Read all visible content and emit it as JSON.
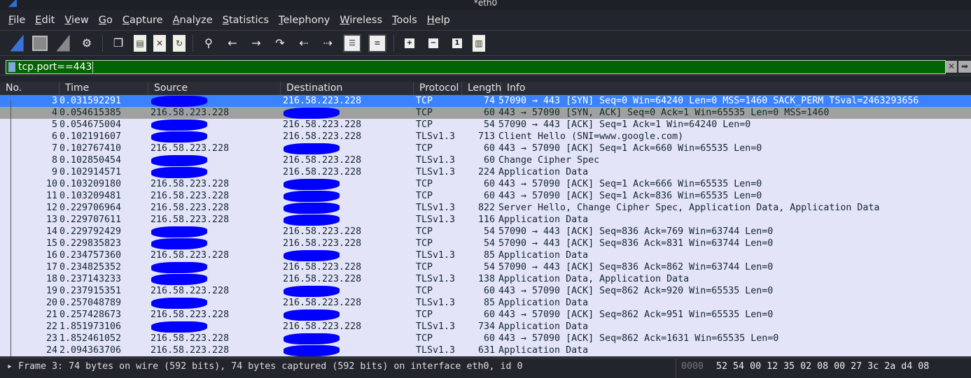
{
  "window": {
    "title": "*eth0"
  },
  "menu": [
    "File",
    "Edit",
    "View",
    "Go",
    "Capture",
    "Analyze",
    "Statistics",
    "Telephony",
    "Wireless",
    "Tools",
    "Help"
  ],
  "toolbar": {
    "icons": [
      "start-capture",
      "stop-capture",
      "restart-capture",
      "capture-options",
      "open-file",
      "file-info",
      "close-file",
      "reload-file",
      "find-packet",
      "go-back",
      "go-forward",
      "go-to-packet",
      "first-packet",
      "last-packet",
      "auto-scroll",
      "colorize",
      "zoom-in",
      "zoom-out",
      "normal-size",
      "resize-columns"
    ]
  },
  "filter": {
    "value": "tcp.port==443"
  },
  "columns": [
    "No.",
    "Time",
    "Source",
    "Destination",
    "Protocol",
    "Length",
    "Info"
  ],
  "colors": {
    "selected": "#3b82ff",
    "row": "#e4e4f8",
    "filter_ok": "#006400",
    "redaction": "#0000ff"
  },
  "packets": [
    {
      "no": "3",
      "time": "0.031592291",
      "src": "",
      "dst": "216.58.223.228",
      "proto": "TCP",
      "len": "74",
      "info": "57090 → 443 [SYN] Seq=0 Win=64240 Len=0 MSS=1460 SACK_PERM TSval=2463293656"
    },
    {
      "no": "4",
      "time": "0.054615385",
      "src": "216.58.223.228",
      "dst": "",
      "proto": "TCP",
      "len": "60",
      "info": "443 → 57090 [SYN, ACK] Seq=0 Ack=1 Win=65535 Len=0 MSS=1460"
    },
    {
      "no": "5",
      "time": "0.054675004",
      "src": "",
      "dst": "216.58.223.228",
      "proto": "TCP",
      "len": "54",
      "info": "57090 → 443 [ACK] Seq=1 Ack=1 Win=64240 Len=0"
    },
    {
      "no": "6",
      "time": "0.102191607",
      "src": "",
      "dst": "216.58.223.228",
      "proto": "TLSv1.3",
      "len": "713",
      "info": "Client Hello (SNI=www.google.com)"
    },
    {
      "no": "7",
      "time": "0.102767410",
      "src": "216.58.223.228",
      "dst": "",
      "proto": "TCP",
      "len": "60",
      "info": "443 → 57090 [ACK] Seq=1 Ack=660 Win=65535 Len=0"
    },
    {
      "no": "8",
      "time": "0.102850454",
      "src": "",
      "dst": "216.58.223.228",
      "proto": "TLSv1.3",
      "len": "60",
      "info": "Change Cipher Spec"
    },
    {
      "no": "9",
      "time": "0.102914571",
      "src": "",
      "dst": "216.58.223.228",
      "proto": "TLSv1.3",
      "len": "224",
      "info": "Application Data"
    },
    {
      "no": "10",
      "time": "0.103209180",
      "src": "216.58.223.228",
      "dst": "",
      "proto": "TCP",
      "len": "60",
      "info": "443 → 57090 [ACK] Seq=1 Ack=666 Win=65535 Len=0"
    },
    {
      "no": "11",
      "time": "0.103209481",
      "src": "216.58.223.228",
      "dst": "",
      "proto": "TCP",
      "len": "60",
      "info": "443 → 57090 [ACK] Seq=1 Ack=836 Win=65535 Len=0"
    },
    {
      "no": "12",
      "time": "0.229706964",
      "src": "216.58.223.228",
      "dst": "",
      "proto": "TLSv1.3",
      "len": "822",
      "info": "Server Hello, Change Cipher Spec, Application Data, Application Data"
    },
    {
      "no": "13",
      "time": "0.229707611",
      "src": "216.58.223.228",
      "dst": "",
      "proto": "TLSv1.3",
      "len": "116",
      "info": "Application Data"
    },
    {
      "no": "14",
      "time": "0.229792429",
      "src": "",
      "dst": "216.58.223.228",
      "proto": "TCP",
      "len": "54",
      "info": "57090 → 443 [ACK] Seq=836 Ack=769 Win=63744 Len=0"
    },
    {
      "no": "15",
      "time": "0.229835823",
      "src": "",
      "dst": "216.58.223.228",
      "proto": "TCP",
      "len": "54",
      "info": "57090 → 443 [ACK] Seq=836 Ack=831 Win=63744 Len=0"
    },
    {
      "no": "16",
      "time": "0.234757360",
      "src": "216.58.223.228",
      "dst": "",
      "proto": "TLSv1.3",
      "len": "85",
      "info": "Application Data"
    },
    {
      "no": "17",
      "time": "0.234825352",
      "src": "",
      "dst": "216.58.223.228",
      "proto": "TCP",
      "len": "54",
      "info": "57090 → 443 [ACK] Seq=836 Ack=862 Win=63744 Len=0"
    },
    {
      "no": "18",
      "time": "0.237143233",
      "src": "",
      "dst": "216.58.223.228",
      "proto": "TLSv1.3",
      "len": "138",
      "info": "Application Data, Application Data"
    },
    {
      "no": "19",
      "time": "0.237915351",
      "src": "216.58.223.228",
      "dst": "",
      "proto": "TCP",
      "len": "60",
      "info": "443 → 57090 [ACK] Seq=862 Ack=920 Win=65535 Len=0"
    },
    {
      "no": "20",
      "time": "0.257048789",
      "src": "",
      "dst": "216.58.223.228",
      "proto": "TLSv1.3",
      "len": "85",
      "info": "Application Data"
    },
    {
      "no": "21",
      "time": "0.257428673",
      "src": "216.58.223.228",
      "dst": "",
      "proto": "TCP",
      "len": "60",
      "info": "443 → 57090 [ACK] Seq=862 Ack=951 Win=65535 Len=0"
    },
    {
      "no": "22",
      "time": "1.851973106",
      "src": "",
      "dst": "216.58.223.228",
      "proto": "TLSv1.3",
      "len": "734",
      "info": "Application Data"
    },
    {
      "no": "23",
      "time": "1.852461052",
      "src": "216.58.223.228",
      "dst": "",
      "proto": "TCP",
      "len": "60",
      "info": "443 → 57090 [ACK] Seq=862 Ack=1631 Win=65535 Len=0"
    },
    {
      "no": "24",
      "time": "2.094363706",
      "src": "216.58.223.228",
      "dst": "",
      "proto": "TLSv1.3",
      "len": "631",
      "info": "Application Data"
    }
  ],
  "detail": {
    "frame": "Frame 3: 74 bytes on wire (592 bits), 74 bytes captured (592 bits) on interface eth0, id 0",
    "hex_offset": "0000",
    "hex_bytes": "52 54 00 12 35 02 08 00  27 3c 2a d4 08"
  }
}
